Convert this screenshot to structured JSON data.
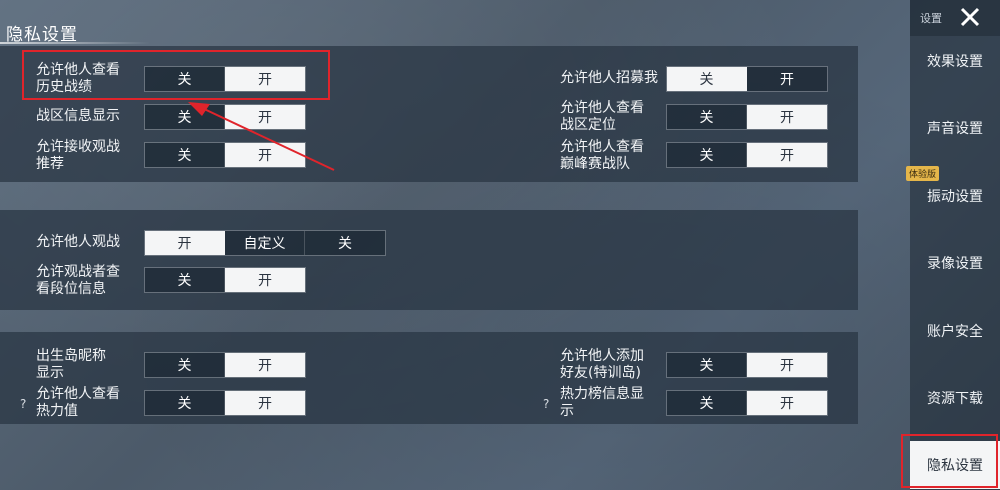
{
  "page": {
    "title": "隐私设置"
  },
  "sidebar": {
    "top_label": "设置",
    "items": [
      {
        "label": "效果设置"
      },
      {
        "label": "声音设置"
      },
      {
        "label": "振动设置",
        "badge": "体验版"
      },
      {
        "label": "录像设置"
      },
      {
        "label": "账户安全"
      },
      {
        "label": "资源下载"
      },
      {
        "label": "隐私设置",
        "active": true
      }
    ]
  },
  "section1": {
    "history": {
      "label": "允许他人查看\n历史战绩",
      "off": "关",
      "on": "开",
      "selected": "on"
    },
    "region_info": {
      "label": "战区信息显示",
      "off": "关",
      "on": "开",
      "selected": "on"
    },
    "recommend": {
      "label": "允许接收观战\n推荐",
      "off": "关",
      "on": "开",
      "selected": "on"
    },
    "recruit": {
      "label": "允许他人招募我",
      "off": "关",
      "on": "开",
      "selected": "off"
    },
    "region_locate": {
      "label": "允许他人查看\n战区定位",
      "off": "关",
      "on": "开",
      "selected": "on"
    },
    "peak_team": {
      "label": "允许他人查看\n巅峰赛战队",
      "off": "关",
      "on": "开",
      "selected": "on"
    }
  },
  "section2": {
    "spectate": {
      "label": "允许他人观战",
      "opt1": "开",
      "opt2": "自定义",
      "opt3": "关",
      "selected": "opt1"
    },
    "rank_info": {
      "label": "允许观战者查\n看段位信息",
      "off": "关",
      "on": "开",
      "selected": "on"
    }
  },
  "section3": {
    "island_name": {
      "label": "出生岛昵称\n显示",
      "off": "关",
      "on": "开",
      "selected": "on"
    },
    "heat_value": {
      "label": "允许他人查看\n热力值",
      "help": "?",
      "off": "关",
      "on": "开",
      "selected": "on"
    },
    "add_friend": {
      "label": "允许他人添加\n好友(特训岛)",
      "off": "关",
      "on": "开",
      "selected": "on"
    },
    "heat_rank": {
      "label": "热力榜信息显\n示",
      "help": "?",
      "off": "关",
      "on": "开",
      "selected": "on"
    }
  },
  "colors": {
    "selected_bg": "#f4f5f6",
    "highlight_red": "#e0242b"
  }
}
